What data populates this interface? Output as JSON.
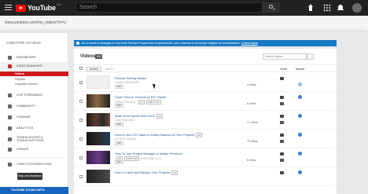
{
  "topbar": {
    "logo": "YouTube",
    "logo_region": "CA",
    "search_placeholder": "Search"
  },
  "browser": {
    "url": "www.youtube.com/my_videos?o=U"
  },
  "sidebar": {
    "header": "CREATOR STUDIO",
    "items": [
      {
        "label": "DASHBOARD",
        "icon": "dashboard-icon"
      },
      {
        "label": "VIDEO MANAGER",
        "icon": "video-manager-icon"
      },
      {
        "label": "LIVE STREAMING",
        "icon": "live-streaming-icon"
      },
      {
        "label": "COMMUNITY",
        "icon": "community-icon"
      },
      {
        "label": "CHANNEL",
        "icon": "channel-icon"
      },
      {
        "label": "ANALYTICS",
        "icon": "analytics-icon"
      },
      {
        "label": "TRANSLATIONS & TRANSCRIPTIONS",
        "icon": "translations-icon"
      },
      {
        "label": "CREATE",
        "icon": "create-icon"
      },
      {
        "label": "YOUR CONTRIBUTIONS",
        "icon": "contributions-icon"
      }
    ],
    "subitems": [
      "Videos",
      "Playlists",
      "Copyright Notices"
    ],
    "feedback": "Help and feedback",
    "beta": "YOUTUBE STUDIO BETA"
  },
  "banner": {
    "text": "As a result of changes to YouTube Partner Programme requirements, your channel is no longer eligible for monetisation.",
    "link": "Learn more"
  },
  "main": {
    "title": "Videos",
    "count": "266",
    "search_placeholder": "Search videos",
    "actions": "Actions",
    "add_to": "Add to",
    "col_views": "Views",
    "col_newest": "Newest",
    "edit": "Edit",
    "videos": [
      {
        "title": "Simcoe Fishing Master",
        "date": "23 Mar 2018 4:08 PM",
        "views": "4 views",
        "hd": false
      },
      {
        "title": "Cycle Simcoe Horseshoe BIY Master",
        "date": "20 Mar 2018 18:31",
        "views": "6 views",
        "hd": true,
        "subtitles": "SUBTITLES"
      },
      {
        "title": "Brian Hunt Sports Reel 2018",
        "date": "1 Mar 2018 18:21",
        "views": "17 views",
        "hd": true
      },
      {
        "title": "How to use LTO Tapes to Safely Backup All Your Projects",
        "date": "15 Feb 2018 16:39",
        "views": "70 views",
        "hd": true
      },
      {
        "title": "How To Use Project Manager in Adobe Premiere",
        "date": "14 Feb 2018 13:23",
        "views": "6 views",
        "hd": true,
        "subtitles": "SUBTITLES"
      },
      {
        "title": "How to Label and Backup Your Projects",
        "date": "",
        "views": "",
        "hd": true
      }
    ]
  }
}
